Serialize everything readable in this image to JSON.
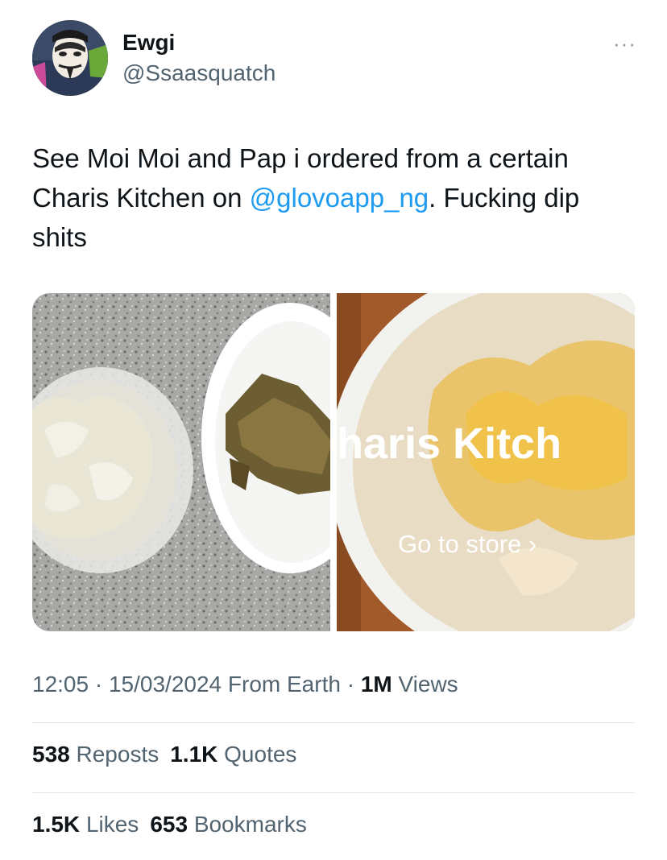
{
  "tweet": {
    "author_name": "Ewgi",
    "author_handle": "@Ssaasquatch",
    "more_label": "···",
    "text_part1": "See Moi Moi and Pap i ordered from a certain Charis Kitchen on ",
    "mention": "@glovoapp_ng",
    "text_part2": ". Fucking dip shits",
    "media": {
      "overlay_title": "haris Kitch",
      "overlay_cta": "Go to store ›"
    },
    "time": "12:05",
    "date": "15/03/2024",
    "source": "From Earth",
    "views_count": "1M",
    "views_label": "Views",
    "reposts_count": "538",
    "reposts_label": "Reposts",
    "quotes_count": "1.1K",
    "quotes_label": "Quotes",
    "likes_count": "1.5K",
    "likes_label": "Likes",
    "bookmarks_count": "653",
    "bookmarks_label": "Bookmarks"
  },
  "colors": {
    "text": "#0f1419",
    "secondary": "#536471",
    "link": "#1d9bf0"
  }
}
